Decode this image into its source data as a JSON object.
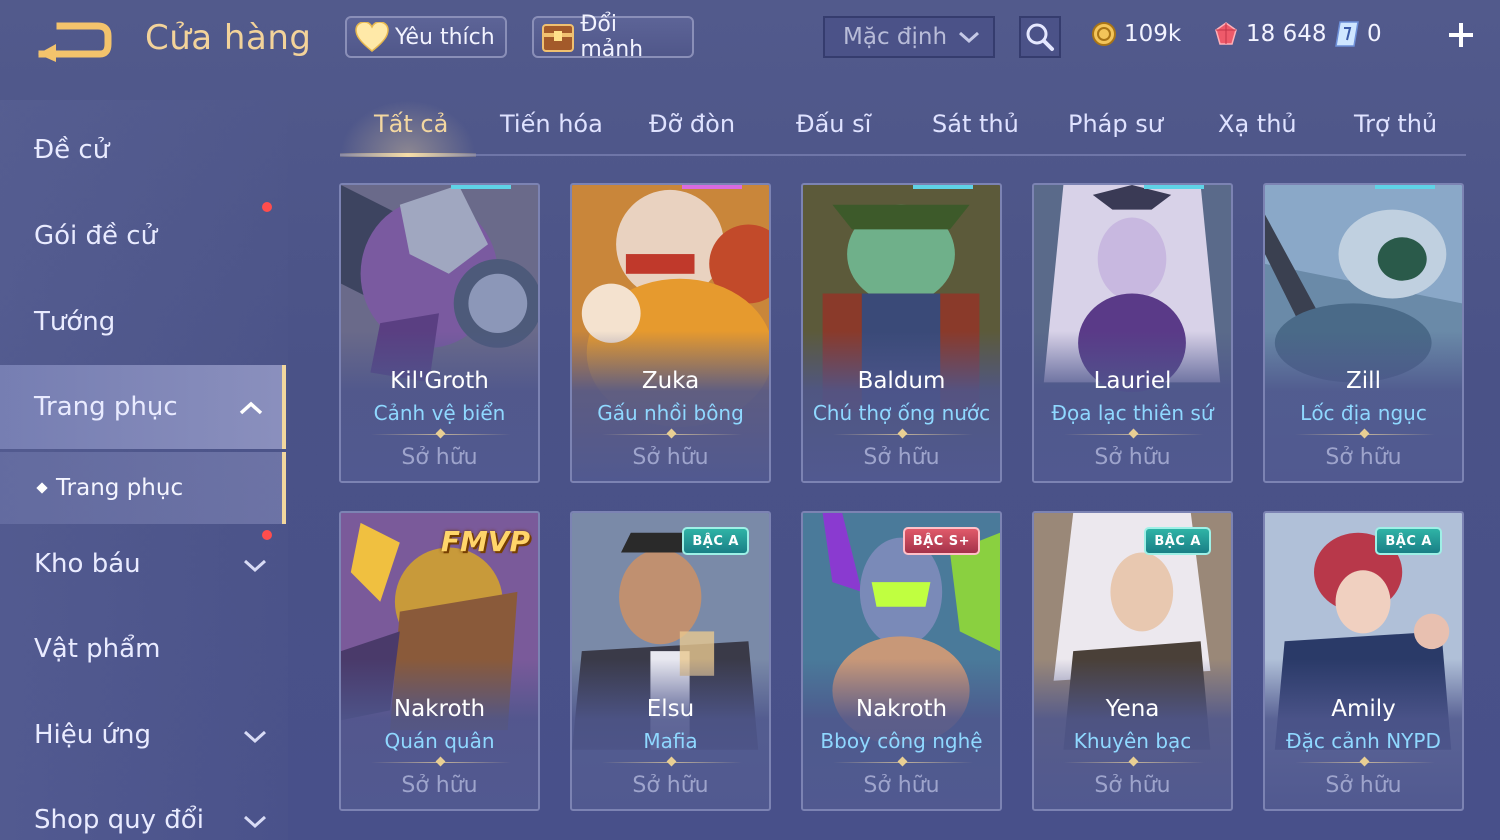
{
  "header": {
    "title": "Cửa hàng",
    "favorite_label": "Yêu thích",
    "exchange_label": "Đổi mảnh",
    "sort_value": "Mặc định",
    "currencies": {
      "gold": "109k",
      "gem": "18 648",
      "voucher": "0"
    }
  },
  "sidebar": {
    "items": [
      {
        "label": "Đề cử"
      },
      {
        "label": "Gói đề cử"
      },
      {
        "label": "Tướng"
      },
      {
        "label": "Trang phục"
      },
      {
        "label": "Kho báu"
      },
      {
        "label": "Vật phẩm"
      },
      {
        "label": "Hiệu ứng"
      },
      {
        "label": "Shop quy đổi"
      }
    ],
    "subitem": "Trang phục"
  },
  "tabs": [
    "Tất cả",
    "Tiến hóa",
    "Đỡ đòn",
    "Đấu sĩ",
    "Sát thủ",
    "Pháp sư",
    "Xạ thủ",
    "Trợ thủ"
  ],
  "cards": [
    {
      "hero": "Kil'Groth",
      "skin": "Cảnh vệ biển",
      "status": "Sở hữu",
      "badge": ""
    },
    {
      "hero": "Zuka",
      "skin": "Gấu nhồi bông",
      "status": "Sở hữu",
      "badge": ""
    },
    {
      "hero": "Baldum",
      "skin": "Chú thợ ống nước",
      "status": "Sở hữu",
      "badge": ""
    },
    {
      "hero": "Lauriel",
      "skin": "Đọa lạc thiên sứ",
      "status": "Sở hữu",
      "badge": ""
    },
    {
      "hero": "Zill",
      "skin": "Lốc địa ngục",
      "status": "Sở hữu",
      "badge": ""
    },
    {
      "hero": "Nakroth",
      "skin": "Quán quân",
      "status": "Sở hữu",
      "badge": "FMVP"
    },
    {
      "hero": "Elsu",
      "skin": "Mafia",
      "status": "Sở hữu",
      "badge": "BẬC A"
    },
    {
      "hero": "Nakroth",
      "skin": "Bboy công nghệ",
      "status": "Sở hữu",
      "badge": "BẬC S+"
    },
    {
      "hero": "Yena",
      "skin": "Khuyên bạc",
      "status": "Sở hữu",
      "badge": "BẬC A"
    },
    {
      "hero": "Amily",
      "skin": "Đặc cảnh NYPD",
      "status": "Sở hữu",
      "badge": "BẬC A"
    }
  ],
  "colors": {
    "accent_gold": "#f3d7a0",
    "skin_blue": "#8fd8ff",
    "notification_red": "#ff4d4d"
  }
}
